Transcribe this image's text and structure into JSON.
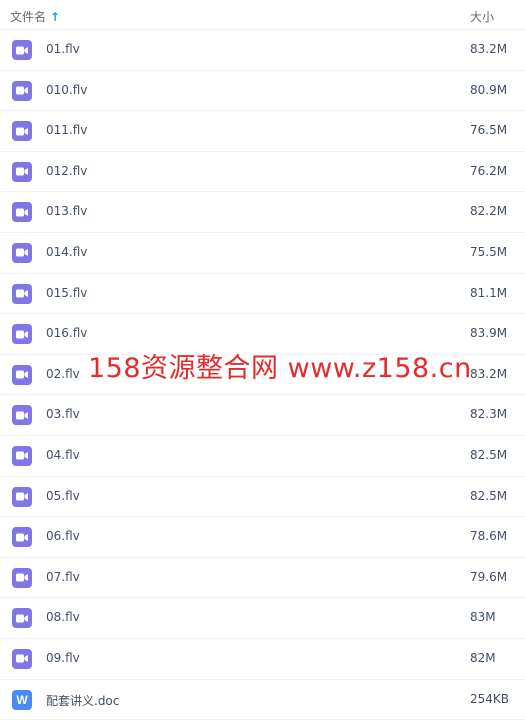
{
  "header": {
    "name_label": "文件名",
    "sort_icon": "arrow-up-icon",
    "size_label": "大小"
  },
  "colors": {
    "video_icon": "#8076e8",
    "doc_icon": "#4a8af4",
    "sort_accent": "#06a7ff",
    "watermark": "#e42c2c"
  },
  "files": [
    {
      "name": "01.flv",
      "size": "83.2M",
      "type": "video"
    },
    {
      "name": "010.flv",
      "size": "80.9M",
      "type": "video"
    },
    {
      "name": "011.flv",
      "size": "76.5M",
      "type": "video"
    },
    {
      "name": "012.flv",
      "size": "76.2M",
      "type": "video"
    },
    {
      "name": "013.flv",
      "size": "82.2M",
      "type": "video"
    },
    {
      "name": "014.flv",
      "size": "75.5M",
      "type": "video"
    },
    {
      "name": "015.flv",
      "size": "81.1M",
      "type": "video"
    },
    {
      "name": "016.flv",
      "size": "83.9M",
      "type": "video"
    },
    {
      "name": "02.flv",
      "size": "83.2M",
      "type": "video"
    },
    {
      "name": "03.flv",
      "size": "82.3M",
      "type": "video"
    },
    {
      "name": "04.flv",
      "size": "82.5M",
      "type": "video"
    },
    {
      "name": "05.flv",
      "size": "82.5M",
      "type": "video"
    },
    {
      "name": "06.flv",
      "size": "78.6M",
      "type": "video"
    },
    {
      "name": "07.flv",
      "size": "79.6M",
      "type": "video"
    },
    {
      "name": "08.flv",
      "size": "83M",
      "type": "video"
    },
    {
      "name": "09.flv",
      "size": "82M",
      "type": "video"
    },
    {
      "name": "配套讲义.doc",
      "size": "254KB",
      "type": "doc",
      "icon_letter": "W"
    }
  ],
  "watermark": "158资源整合网 www.z158.cn"
}
